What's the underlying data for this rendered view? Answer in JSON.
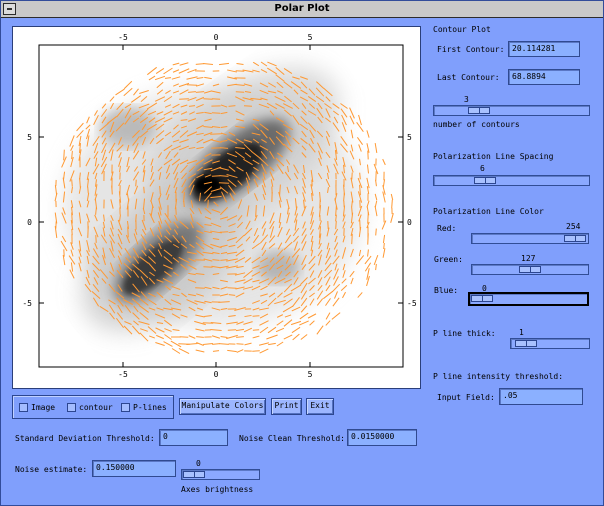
{
  "window": {
    "title": "Polar Plot"
  },
  "plot": {
    "x_ticks": [
      "-5",
      "0",
      "5"
    ],
    "y_ticks": [
      "5",
      "0",
      "-5"
    ],
    "vector_color": "#ff9933"
  },
  "contour_plot": {
    "header": "Contour Plot",
    "first_label": "First Contour:",
    "first_value": "20.114281",
    "last_label": "Last Contour:",
    "last_value": "68.8894",
    "count_value": "3",
    "count_fraction": 0.25,
    "count_label": "number of contours"
  },
  "polarization": {
    "spacing_header": "Polarization Line Spacing",
    "spacing_value": "6",
    "spacing_fraction": 0.3,
    "color_header": "Polarization Line Color",
    "red_label": "Red:",
    "red_value": "254",
    "red_fraction": 0.99,
    "green_label": "Green:",
    "green_value": "127",
    "green_fraction": 0.5,
    "blue_label": "Blue:",
    "blue_value": "0",
    "blue_fraction": 0.0,
    "thick_label": "P line thick:",
    "thick_value": "1",
    "thick_fraction": 0.05,
    "threshold_header": "P line intensity threshold:",
    "input_label": "Input Field:",
    "input_value": ".05"
  },
  "controls": {
    "image_label": "Image",
    "contour_label": "contour",
    "plines_label": "P-lines",
    "manipulate_label": "Manipulate Colors",
    "print_label": "Print",
    "exit_label": "Exit"
  },
  "bottom": {
    "std_label": "Standard Deviation Threshold:",
    "std_value": "0",
    "noise_clean_label": "Noise Clean Threshold:",
    "noise_clean_value": "0.0150000",
    "noise_est_label": "Noise estimate:",
    "noise_est_value": "0.150000",
    "brightness_value": "0",
    "brightness_fraction": 0.0,
    "brightness_label": "Axes brightness"
  }
}
